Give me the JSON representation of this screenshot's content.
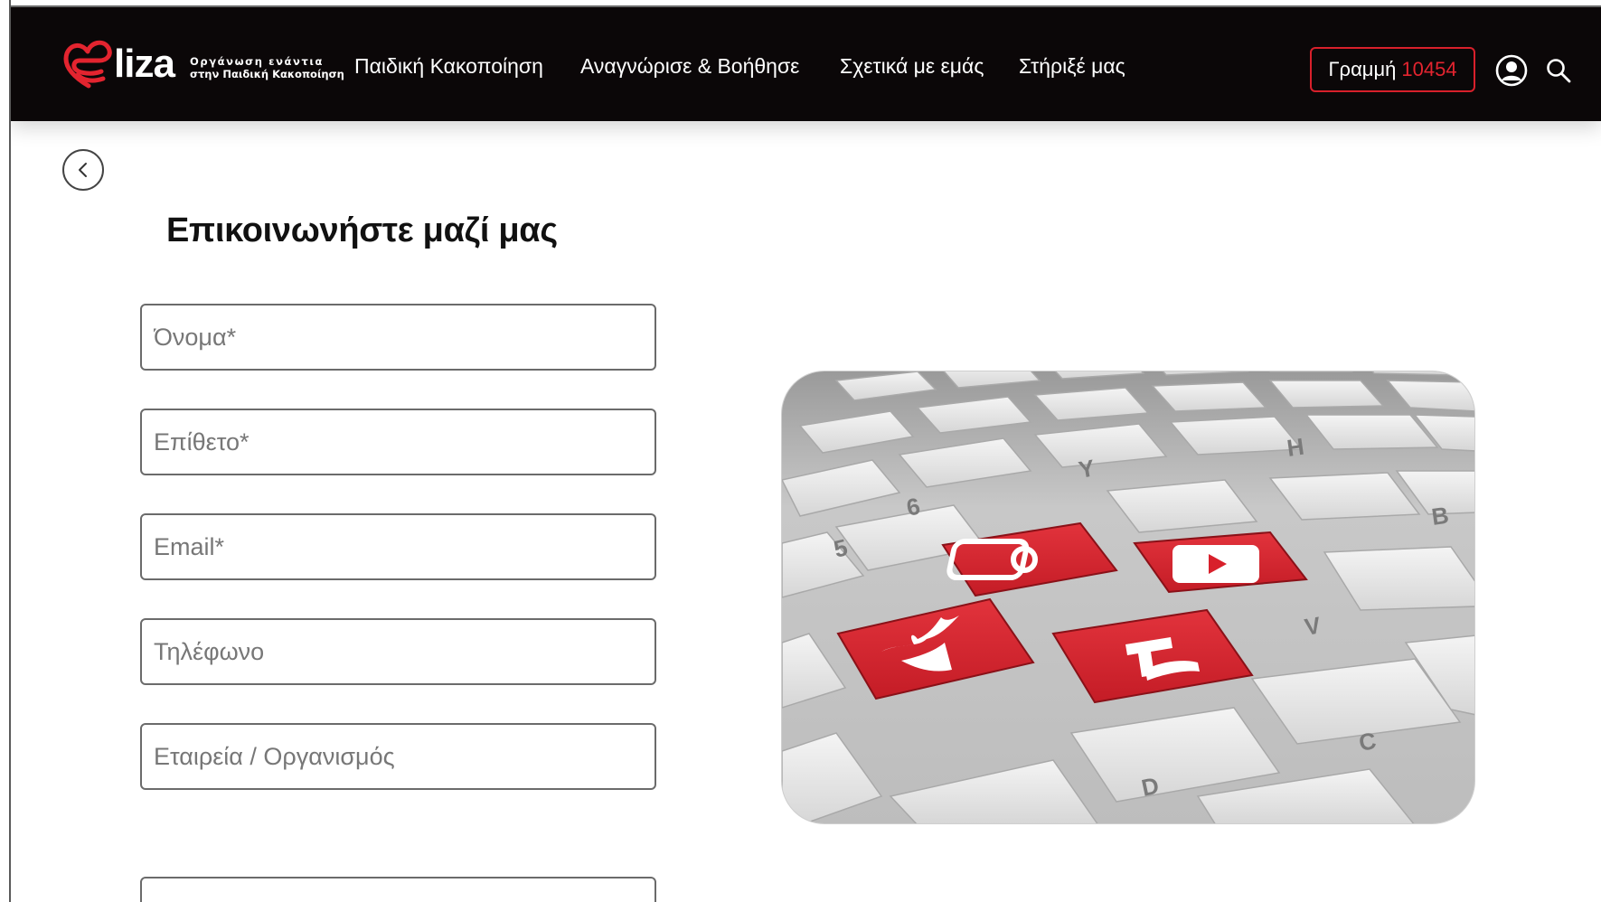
{
  "header": {
    "logo": {
      "word": "liza",
      "tagline_line1": "Οργάνωση ενάντια",
      "tagline_line2": "στην Παιδική Κακοποίηση"
    },
    "nav": [
      {
        "label": "Παιδική Κακοποίηση"
      },
      {
        "label": "Αναγνώρισε & Βοήθησε"
      },
      {
        "label": "Σχετικά με εμάς"
      },
      {
        "label": "Στήριξέ μας"
      }
    ],
    "hotline": {
      "label": "Γραμμή",
      "number": "10454"
    },
    "icons": [
      "user-icon",
      "search-icon"
    ]
  },
  "page": {
    "back_icon": "chevron-left-icon",
    "title": "Επικοινωνήστε μαζί μας"
  },
  "form": {
    "fields": [
      {
        "placeholder": "Όνομα*",
        "value": ""
      },
      {
        "placeholder": "Επίθετο*",
        "value": ""
      },
      {
        "placeholder": "Email*",
        "value": ""
      },
      {
        "placeholder": "Τηλέφωνο",
        "value": ""
      },
      {
        "placeholder": "Εταιρεία / Οργανισμός",
        "value": ""
      },
      {
        "placeholder": "",
        "value": ""
      }
    ]
  },
  "image": {
    "description_icons": [
      "instagram-icon",
      "youtube-icon",
      "twitter-icon",
      "facebook-icon"
    ]
  },
  "colors": {
    "header_bg": "#0b0708",
    "accent_red": "#d8202b",
    "text_dark": "#111111",
    "field_border": "#6b6b6b"
  }
}
